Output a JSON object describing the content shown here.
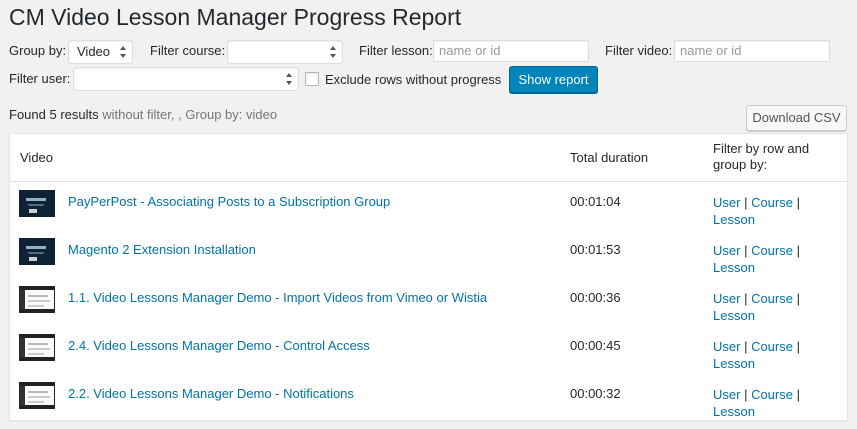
{
  "page": {
    "title": "CM Video Lesson Manager Progress Report"
  },
  "filters": {
    "group_by_label": "Group by:",
    "group_by_value": "Video",
    "filter_course_label": "Filter course:",
    "filter_course_value": "",
    "filter_lesson_label": "Filter lesson:",
    "filter_lesson_placeholder": "name or id",
    "filter_video_label": "Filter video:",
    "filter_video_placeholder": "name or id",
    "filter_user_label": "Filter user:",
    "filter_user_value": "",
    "exclude_label": "Exclude rows without progress",
    "show_report_label": "Show report"
  },
  "results": {
    "found_text": "Found 5 results",
    "meta_text": " without filter, , Group by: video",
    "download_csv_label": "Download CSV"
  },
  "table": {
    "headers": {
      "video": "Video",
      "total_duration": "Total duration",
      "filter_by": "Filter by row and group by:"
    },
    "rows": [
      {
        "title": "PayPerPost - Associating Posts to a Subscription Group",
        "duration": "00:01:04",
        "thumb": "dark-title-card"
      },
      {
        "title": "Magento 2 Extension Installation",
        "duration": "00:01:53",
        "thumb": "dark-title-card"
      },
      {
        "title": "1.1. Video Lessons Manager Demo - Import Videos from Vimeo or Wistia",
        "duration": "00:00:36",
        "thumb": "screen-capture"
      },
      {
        "title": "2.4. Video Lessons Manager Demo - Control Access",
        "duration": "00:00:45",
        "thumb": "screen-capture"
      },
      {
        "title": "2.2. Video Lessons Manager Demo - Notifications",
        "duration": "00:00:32",
        "thumb": "screen-capture"
      }
    ],
    "filter_links": {
      "user": "User",
      "course": "Course",
      "lesson": "Lesson",
      "separator": " | "
    }
  },
  "colors": {
    "link": "#0073aa",
    "primary_button": "#0085ba",
    "background": "#f1f1f1"
  }
}
